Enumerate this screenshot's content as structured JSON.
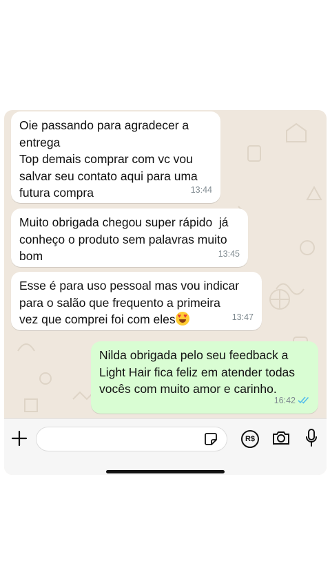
{
  "messages": [
    {
      "direction": "incoming",
      "text": "Oie passando para agradecer a\nentrega\nTop demais comprar com vc vou\nsalvar seu contato aqui para uma\nfutura compra",
      "time": "13:44"
    },
    {
      "direction": "incoming",
      "text": "Muito obrigada chegou super rápido  já\nconheço o produto sem palavras muito\nbom",
      "time": "13:45"
    },
    {
      "direction": "incoming",
      "text": "Esse é para uso pessoal mas vou indicar\npara o salão que frequento a primeira\nvez que comprei foi com eles",
      "emoji": "heart-eyes-emoji",
      "time": "13:47"
    },
    {
      "direction": "outgoing",
      "text": "Nilda obrigada pelo seu feedback a\nLight Hair fica feliz em atender todas\nvocês com muito amor e carinho.",
      "time": "16:42",
      "status": "read",
      "status_icon": "double-check-icon"
    }
  ],
  "input_bar": {
    "icons": [
      "plus-icon",
      "sticker-icon",
      "pix-payment-icon",
      "camera-icon",
      "microphone-icon"
    ],
    "pix_label": "R$"
  },
  "colors": {
    "chat_background": "#efe7dd",
    "incoming_bubble": "#ffffff",
    "outgoing_bubble": "#d9fdd3",
    "read_ticks": "#53bdeb",
    "timestamp": "#7f8a90"
  }
}
